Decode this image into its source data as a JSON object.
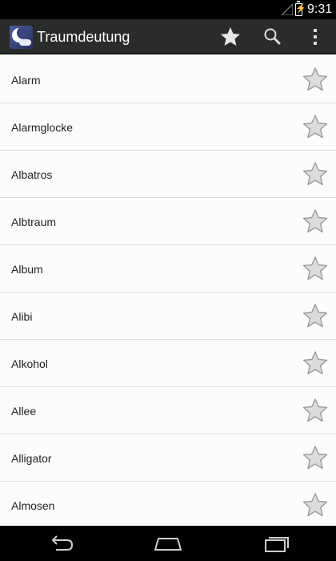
{
  "status_bar": {
    "time": "9:31",
    "icons": [
      "signal-icon",
      "battery-charging-icon"
    ]
  },
  "action_bar": {
    "app_icon": "moon-cloud-app-icon",
    "title": "Traumdeutung",
    "actions": [
      "star-filled-icon",
      "search-icon",
      "overflow-menu-icon"
    ]
  },
  "list": {
    "items": [
      {
        "label": "Alarm",
        "favorite": false
      },
      {
        "label": "Alarmglocke",
        "favorite": false
      },
      {
        "label": "Albatros",
        "favorite": false
      },
      {
        "label": "Albtraum",
        "favorite": false
      },
      {
        "label": "Album",
        "favorite": false
      },
      {
        "label": "Alibi",
        "favorite": false
      },
      {
        "label": "Alkohol",
        "favorite": false
      },
      {
        "label": "Allee",
        "favorite": false
      },
      {
        "label": "Alligator",
        "favorite": false
      },
      {
        "label": "Almosen",
        "favorite": false
      }
    ]
  },
  "nav_bar": {
    "buttons": [
      "back-icon",
      "home-icon",
      "recents-icon"
    ]
  },
  "colors": {
    "action_bar": "#2a2c2b",
    "list_background": "#fbfdfb",
    "divider": "#dcdedc",
    "star_outline": "#9a9a9a"
  }
}
